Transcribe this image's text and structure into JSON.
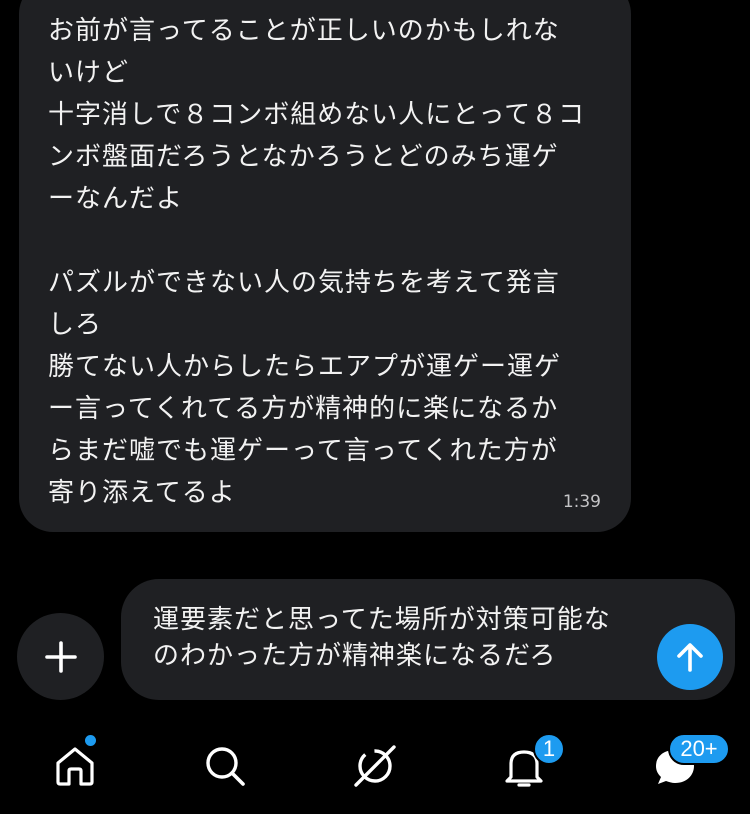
{
  "message": {
    "text": "お前が言ってることが正しいのかもしれな\nいけど\n十字消しで８コンボ組めない人にとって８コ\nンボ盤面だろうとなかろうとどのみち運ゲ\nーなんだよ\n\nパズルができない人の気持ちを考えて発言\nしろ\n勝てない人からしたらエアプが運ゲー運ゲ\nー言ってくれてる方が精神的に楽になるか\nらまだ嘘でも運ゲーって言ってくれた方が\n寄り添えてるよ",
    "time": "1:39"
  },
  "composer": {
    "text": "運要素だと思ってた場所が対策可能な\nのわかった方が精神楽になるだろ",
    "add_icon": "plus-icon",
    "send_icon": "arrow-up-icon"
  },
  "nav": {
    "items": [
      {
        "icon": "home-icon"
      },
      {
        "icon": "search-icon"
      },
      {
        "icon": "grok-icon"
      },
      {
        "icon": "bell-icon",
        "badge": "1"
      },
      {
        "icon": "messages-icon",
        "badge": "20+"
      }
    ]
  },
  "colors": {
    "background": "#000000",
    "bubble": "#1f2023",
    "accent": "#1d9bf0",
    "text": "#f2f2f2",
    "muted": "#c4c4c6"
  }
}
